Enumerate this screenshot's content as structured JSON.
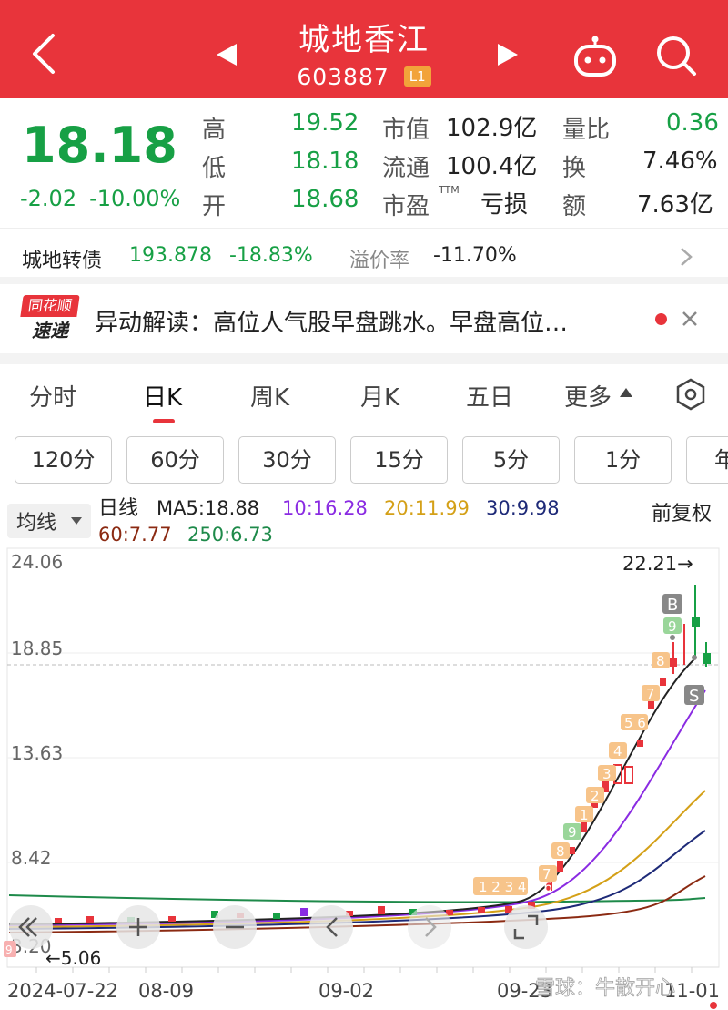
{
  "header": {
    "title": "城地香江",
    "code": "603887",
    "level": "L1"
  },
  "quote": {
    "price": "18.18",
    "change": "-2.02",
    "change_pct": "-10.00%",
    "high_label": "高",
    "high": "19.52",
    "low_label": "低",
    "low": "18.18",
    "open_label": "开",
    "open": "18.68",
    "mcap_label": "市值",
    "mcap": "102.9亿",
    "float_label": "流通",
    "float": "100.4亿",
    "pe_label": "市盈",
    "pe_sup": "TTM",
    "pe": "亏损",
    "vol_ratio_label": "量比",
    "vol_ratio": "0.36",
    "turnover_label": "换",
    "turnover": "7.46%",
    "amount_label": "额",
    "amount": "7.63亿"
  },
  "bond": {
    "name": "城地转债",
    "price": "193.878",
    "pct": "-18.83%",
    "premium_label": "溢价率",
    "premium": "-11.70%"
  },
  "news": {
    "logo_line1": "同花顺",
    "logo_line2": "速递",
    "text": "异动解读：高位人气股早盘跳水。早盘高位…"
  },
  "tabs": [
    "分时",
    "日K",
    "周K",
    "月K",
    "五日",
    "更多"
  ],
  "periods": [
    "120分",
    "60分",
    "30分",
    "15分",
    "5分",
    "1分",
    "年"
  ],
  "ma_legend": {
    "selector": "均线",
    "title": "日线",
    "ma5": "MA5:18.88",
    "ma10": "10:16.28",
    "ma20": "20:11.99",
    "ma30": "30:9.98",
    "ma60": "60:7.77",
    "ma250": "250:6.73",
    "adjust": "前复权"
  },
  "colors": {
    "red": "#e8343b",
    "green": "#17a045",
    "ma5": "#222222",
    "ma10": "#8a2be2",
    "ma20": "#d4a017",
    "ma30": "#1e2a78",
    "ma60": "#8b2a12",
    "ma250": "#1e8a4a"
  },
  "chart": {
    "y_ticks": [
      "24.06",
      "18.85",
      "13.63",
      "8.42",
      "3.20"
    ],
    "high_marker": "22.21→",
    "low_marker": "←5.06",
    "x_ticks": [
      "2024-07-22",
      "08-09",
      "09-02",
      "09-23",
      "11-01"
    ],
    "buy_marker": "B",
    "sell_marker": "S",
    "watermark": "雪球：牛散开心"
  }
}
